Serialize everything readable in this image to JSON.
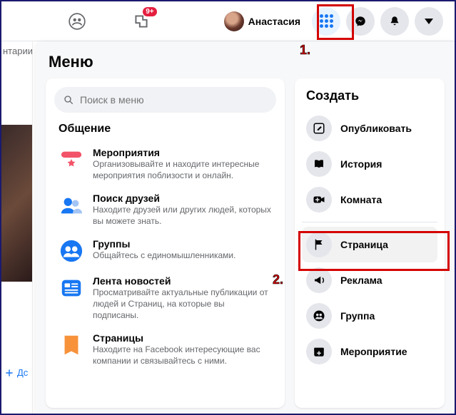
{
  "topbar": {
    "badge": "9+",
    "profile_name": "Анастасия"
  },
  "left_strip": {
    "text_fragment": "нтарии",
    "action_fragment": "Дс"
  },
  "menu": {
    "title": "Меню",
    "search_placeholder": "Поиск в меню",
    "section_heading": "Общение",
    "items": [
      {
        "title": "Мероприятия",
        "desc": "Организовывайте и находите интересные мероприятия поблизости и онлайн."
      },
      {
        "title": "Поиск друзей",
        "desc": "Находите друзей или других людей, которых вы можете знать."
      },
      {
        "title": "Группы",
        "desc": "Общайтесь с единомышленниками."
      },
      {
        "title": "Лента новостей",
        "desc": "Просматривайте актуальные публикации от людей и Страниц, на которые вы подписаны."
      },
      {
        "title": "Страницы",
        "desc": "Находите на Facebook интересующие вас компании и связывайтесь с ними."
      }
    ],
    "create_heading": "Создать",
    "create_items": [
      {
        "label": "Опубликовать"
      },
      {
        "label": "История"
      },
      {
        "label": "Комната"
      },
      {
        "label": "Страница"
      },
      {
        "label": "Реклама"
      },
      {
        "label": "Группа"
      },
      {
        "label": "Мероприятие"
      }
    ]
  },
  "annotations": {
    "label1": "1.",
    "label2": "2."
  }
}
